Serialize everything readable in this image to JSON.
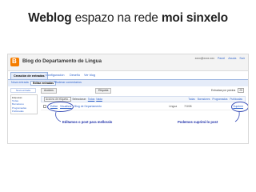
{
  "slide": {
    "title_bold_1": "Weblog",
    "title_normal": " espazo na rede ",
    "title_bold_2": "moi sinxelo"
  },
  "screenshot": {
    "blog_name": "Blog do Departamento de Lingua",
    "account": {
      "email": "xxxx@xxxx.xxx",
      "links": [
        "Panel",
        "Axuda",
        "Saír"
      ]
    },
    "tabs": [
      {
        "label": "Creación de entradas",
        "active": true
      },
      {
        "label": "Configuración",
        "active": false
      },
      {
        "label": "Deseño",
        "active": false
      },
      {
        "label": "Ver blog",
        "active": false
      }
    ],
    "subtabs": [
      {
        "label": "Nova entrada",
        "selected": false
      },
      {
        "label": "Editar entradas",
        "selected": true
      },
      {
        "label": "Moderar comentarios",
        "selected": false
      }
    ],
    "sidebar": {
      "new_post_button": "Nova entrada",
      "list_label": "Etiquetas",
      "list_items": [
        "Todas",
        "Borradores",
        "Programadas",
        "Publicadas"
      ]
    },
    "toolbar": {
      "button_left": "Accións",
      "button_right": "Etiqueta",
      "posts_per_page_label": "Entradas por páxina",
      "posts_per_page_value": "25"
    },
    "filter": {
      "select_label": "Accións de etiqueta...",
      "select_all_label": "Seleccionar:",
      "select_links": [
        "Todas",
        "Nada"
      ],
      "status_links": [
        "Todas",
        "Borradores",
        "Programadas",
        "Publicadas"
      ]
    },
    "post": {
      "edit_label": "Editar",
      "view_label": "Visualizar",
      "title": "Blog de Departamento",
      "author": "Lingua",
      "date": "7/3/08",
      "delete_label": "Suprimir"
    },
    "annotations": {
      "edit_note": "Editamos o post para melloralo",
      "delete_note": "Podemos suprimi-lo post"
    }
  }
}
